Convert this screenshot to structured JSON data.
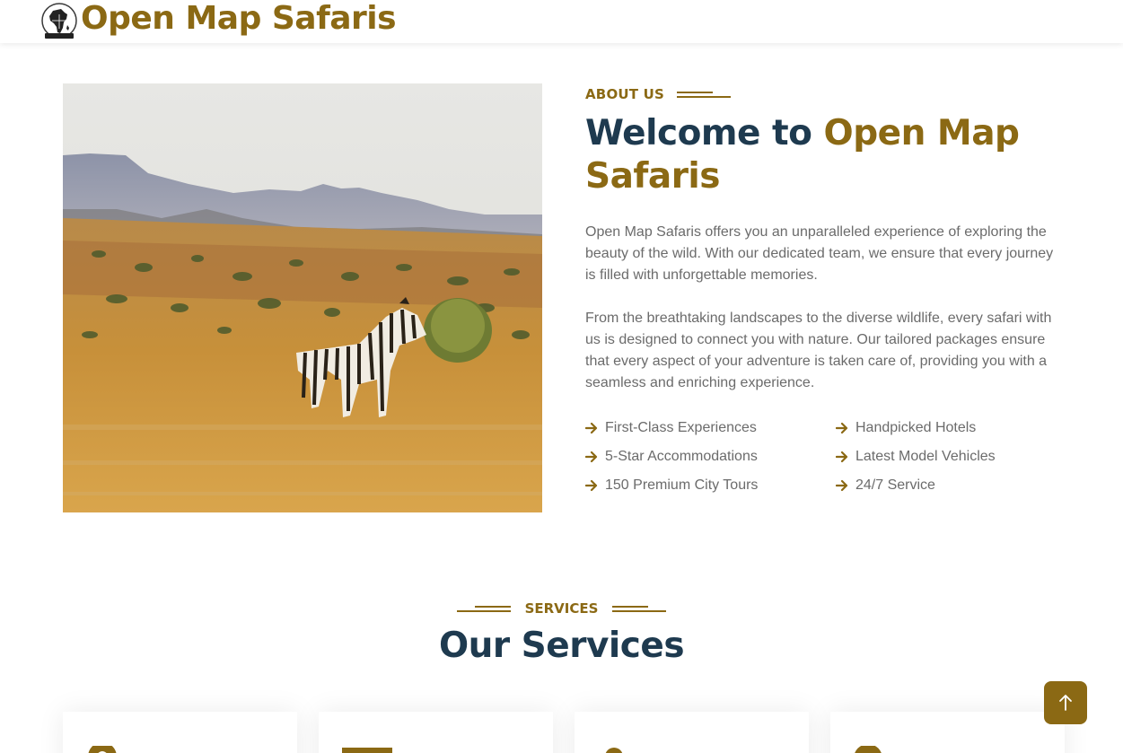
{
  "brand": {
    "name": "Open Map Safaris",
    "logo_icon": "africa-map-logo-icon"
  },
  "colors": {
    "accent": "#8b6914",
    "heading": "#1e3a4f",
    "text": "#6b6b6b"
  },
  "about": {
    "eyebrow": "ABOUT US",
    "title_prefix": "Welcome to ",
    "title_highlight": "Open Map Safaris",
    "paragraphs": [
      "Open Map Safaris offers you an unparalleled experience of exploring the beauty of the wild. With our dedicated team, we ensure that every journey is filled with unforgettable memories.",
      "From the breathtaking landscapes to the diverse wildlife, every safari with us is designed to connect you with nature. Our tailored packages ensure that every aspect of your adventure is taken care of, providing you with a seamless and enriching experience."
    ],
    "features": [
      "First-Class Experiences",
      "Handpicked Hotels",
      "5-Star Accommodations",
      "Latest Model Vehicles",
      "150 Premium City Tours",
      "24/7 Service"
    ],
    "image": {
      "subject": "zebra-in-savanna-photo"
    }
  },
  "services": {
    "eyebrow": "SERVICES",
    "title": "Our Services",
    "card_icons": [
      "globe-icon",
      "hotel-icon",
      "user-icon",
      "cog-icon"
    ]
  },
  "back_to_top": {
    "icon": "arrow-up-icon"
  }
}
